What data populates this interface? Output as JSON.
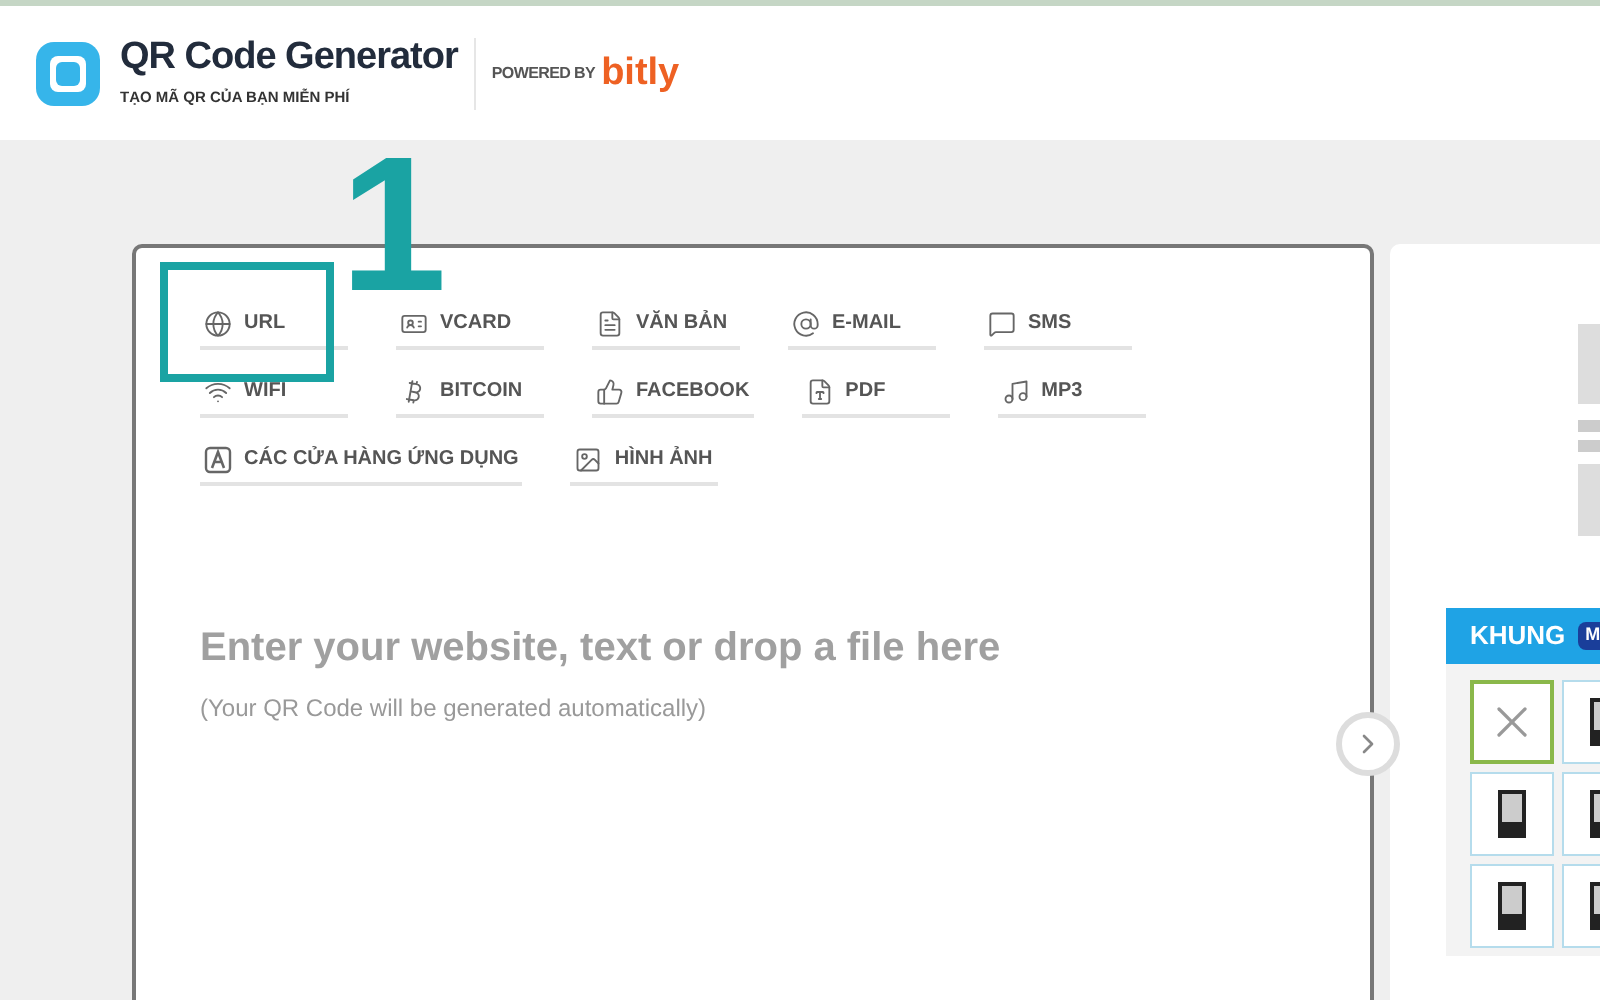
{
  "header": {
    "title": "QR Code Generator",
    "subtitle": "TẠO MÃ QR CỦA BẠN MIỄN PHÍ",
    "powered_by": "POWERED BY",
    "brand": "bitly"
  },
  "annotation": {
    "number": "1"
  },
  "types": [
    {
      "label": "URL"
    },
    {
      "label": "VCARD"
    },
    {
      "label": "VĂN BẢN"
    },
    {
      "label": "E-MAIL"
    },
    {
      "label": "SMS"
    },
    {
      "label": "WIFI"
    },
    {
      "label": "BITCOIN"
    },
    {
      "label": "FACEBOOK"
    },
    {
      "label": "PDF"
    },
    {
      "label": "MP3"
    },
    {
      "label": "CÁC CỬA HÀNG ỨNG DỤNG"
    },
    {
      "label": "HÌNH ẢNH"
    }
  ],
  "input": {
    "placeholder": "Enter your website, text or drop a file here",
    "hint": "(Your QR Code will be generated automatically)"
  },
  "frames": {
    "title": "KHUNG",
    "badge": "M",
    "items": [
      {
        "kind": "none",
        "selected": true
      },
      {
        "kind": "frame",
        "selected": false
      },
      {
        "kind": "frame",
        "selected": false
      },
      {
        "kind": "frame",
        "selected": false
      },
      {
        "kind": "frame",
        "selected": false
      },
      {
        "kind": "frame",
        "selected": false
      }
    ]
  }
}
